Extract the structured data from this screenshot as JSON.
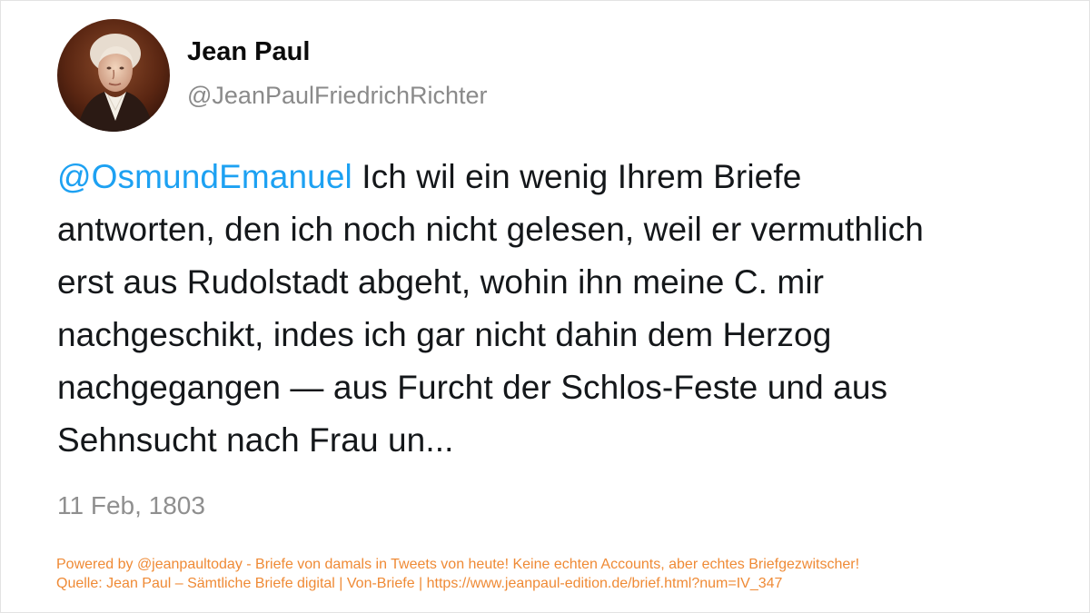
{
  "author": {
    "display_name": "Jean Paul",
    "handle": "@JeanPaulFriedrichRichter",
    "avatar_icon": "portrait-avatar"
  },
  "tweet": {
    "mention": "@OsmundEmanuel",
    "lines": [
      " Ich wil ein wenig Ihrem Briefe",
      "antworten, den ich noch nicht gelesen, weil er vermuthlich",
      "erst aus Rudolstadt abgeht, wohin ihn meine C. mir",
      "nachgeschikt, indes ich gar nicht dahin dem Herzog",
      "nachgegangen — aus Furcht der Schlos-Feste und aus",
      "Sehnsucht nach Frau un..."
    ],
    "date": "11 Feb, 1803"
  },
  "footer": {
    "powered_by": "Powered by @jeanpaultoday - Briefe von damals in Tweets von heute! Keine echten Accounts, aber echtes Briefgezwitscher!",
    "source": "Quelle: Jean Paul – Sämtliche Briefe digital | Von-Briefe | https://www.jeanpaul-edition.de/brief.html?num=IV_347"
  },
  "colors": {
    "mention": "#1da1f2",
    "footer": "#ef8a35",
    "muted": "#8a8a8a",
    "text": "#14171a"
  }
}
